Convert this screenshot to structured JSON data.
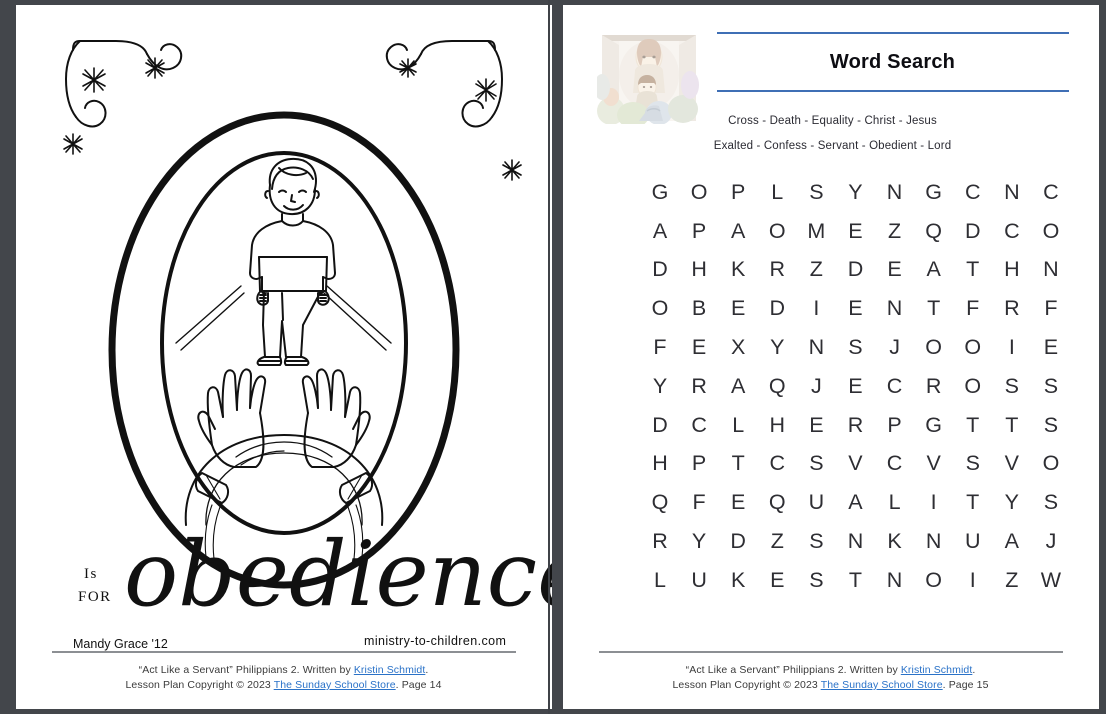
{
  "document": {
    "kind": "two-page-pdf-spread",
    "background_color": "#43464b",
    "page_background": "#ffffff"
  },
  "left_page": {
    "name": "obedience-coloring-page",
    "letter": "O",
    "is_label": "Is",
    "for_label": "FOR",
    "word": "obedience",
    "artist_credit": "Mandy Grace '12",
    "site_credit": "ministry-to-children.com",
    "illustration_alt": "Letter O with a standing boy above upraised praying hands",
    "decor": {
      "corner_flourish_left": "flourish-swirl",
      "corner_flourish_right": "flourish-swirl",
      "stars": 6
    },
    "footer": {
      "line1_pre": "“Act Like a Servant” Philippians 2.  Written by ",
      "line1_link": "Kristin Schmidt",
      "line1_post": ".",
      "line2_pre": "Lesson Plan Copyright © 2023 ",
      "line2_link": "The Sunday School Store",
      "line2_post": ". Page 14",
      "link_color": "#2a72c8"
    }
  },
  "right_page": {
    "name": "word-search-page",
    "thumbnail_alt": "Faded illustration of Jesus holding a child among a crowd",
    "title": "Word Search",
    "rule_color": "#3f6fb5",
    "word_list_line1": "Cross - Death - Equality - Christ - Jesus",
    "word_list_line2": "Exalted - Confess - Servant - Obedient - Lord",
    "words": [
      "Cross",
      "Death",
      "Equality",
      "Christ",
      "Jesus",
      "Exalted",
      "Confess",
      "Servant",
      "Obedient",
      "Lord"
    ],
    "grid": [
      [
        "G",
        "O",
        "P",
        "L",
        "S",
        "Y",
        "N",
        "G",
        "C",
        "N",
        "C"
      ],
      [
        "A",
        "P",
        "A",
        "O",
        "M",
        "E",
        "Z",
        "Q",
        "D",
        "C",
        "O"
      ],
      [
        "D",
        "H",
        "K",
        "R",
        "Z",
        "D",
        "E",
        "A",
        "T",
        "H",
        "N"
      ],
      [
        "O",
        "B",
        "E",
        "D",
        "I",
        "E",
        "N",
        "T",
        "F",
        "R",
        "F"
      ],
      [
        "F",
        "E",
        "X",
        "Y",
        "N",
        "S",
        "J",
        "O",
        "O",
        "I",
        "E"
      ],
      [
        "Y",
        "R",
        "A",
        "Q",
        "J",
        "E",
        "C",
        "R",
        "O",
        "S",
        "S"
      ],
      [
        "D",
        "C",
        "L",
        "H",
        "E",
        "R",
        "P",
        "G",
        "T",
        "T",
        "S"
      ],
      [
        "H",
        "P",
        "T",
        "C",
        "S",
        "V",
        "C",
        "V",
        "S",
        "V",
        "O"
      ],
      [
        "Q",
        "F",
        "E",
        "Q",
        "U",
        "A",
        "L",
        "I",
        "T",
        "Y",
        "S"
      ],
      [
        "R",
        "Y",
        "D",
        "Z",
        "S",
        "N",
        "K",
        "N",
        "U",
        "A",
        "J"
      ],
      [
        "L",
        "U",
        "K",
        "E",
        "S",
        "T",
        "N",
        "O",
        "I",
        "Z",
        "W"
      ]
    ],
    "footer": {
      "line1_pre": "“Act Like a Servant” Philippians 2.  Written by ",
      "line1_link": "Kristin Schmidt",
      "line1_post": ".",
      "line2_pre": "Lesson Plan Copyright © 2023 ",
      "line2_link": "The Sunday School Store",
      "line2_post": ". Page 15",
      "link_color": "#2a72c8"
    }
  }
}
